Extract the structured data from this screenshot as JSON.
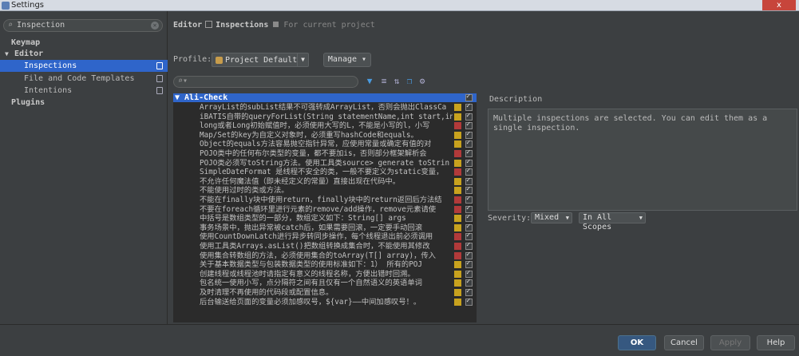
{
  "window": {
    "title": "Settings",
    "close_label": "x"
  },
  "left": {
    "search_value": "Inspection",
    "tree": [
      {
        "label": "Keymap",
        "bold": true,
        "indent": 1
      },
      {
        "label": "Editor",
        "bold": true,
        "indent": 0,
        "arrow": "▼"
      },
      {
        "label": "Inspections",
        "selected": true,
        "indent": 3
      },
      {
        "label": "File and Code Templates",
        "indent": 3
      },
      {
        "label": "Intentions",
        "indent": 3
      },
      {
        "label": "Plugins",
        "bold": true,
        "indent": 1
      }
    ]
  },
  "header": {
    "crumb_editor": "Editor",
    "crumb_inspections": "Inspections",
    "note": "For current project"
  },
  "profile": {
    "label": "Profile:",
    "value": "Project Default",
    "manage_label": "Manage ▾"
  },
  "list": {
    "group": "▼ Ali-Check",
    "rows": [
      {
        "text": "ArrayList的subList结果不可强转成ArrayList，否则会抛出ClassCa",
        "sev": "#c8a21e"
      },
      {
        "text": "iBATIS自带的queryForList(String statementName,int start,int",
        "sev": "#c8a21e"
      },
      {
        "text": "long或者Long初始赋值时，必须使用大写的L，不能是小写的l，小写",
        "sev": "#b23a3a"
      },
      {
        "text": "Map/Set的key为自定义对象时，必须重写hashCode和equals。",
        "sev": "#c8a21e"
      },
      {
        "text": "Object的equals方法容易抛空指针异常，应使用常量或确定有值的对",
        "sev": "#c8a21e"
      },
      {
        "text": "POJO类中的任何布尔类型的变量，都不要加is，否则部分框架解析会",
        "sev": "#b23a3a"
      },
      {
        "text": "POJO类必须写toString方法。使用工具类source> generate toStrin",
        "sev": "#c8a21e"
      },
      {
        "text": "SimpleDateFormat 是线程不安全的类，一般不要定义为static变量，",
        "sev": "#b23a3a"
      },
      {
        "text": "不允许任何魔法值（即未经定义的常量）直接出现在代码中。",
        "sev": "#c8a21e"
      },
      {
        "text": "不能使用过时的类或方法。",
        "sev": "#c8a21e"
      },
      {
        "text": "不能在finally块中使用return，finally块中的return返回后方法结",
        "sev": "#b23a3a"
      },
      {
        "text": "不要在foreach循环里进行元素的remove/add操作，remove元素请使",
        "sev": "#b23a3a"
      },
      {
        "text": "中括号是数组类型的一部分，数组定义如下：String[] args",
        "sev": "#c8a21e"
      },
      {
        "text": "事务场景中，抛出异常被catch后，如果需要回滚，一定要手动回滚",
        "sev": "#c8a21e"
      },
      {
        "text": "使用CountDownLatch进行异步转同步操作，每个线程退出前必须调用",
        "sev": "#b23a3a"
      },
      {
        "text": "使用工具类Arrays.asList()把数组转换成集合时，不能使用其修改",
        "sev": "#b23a3a"
      },
      {
        "text": "使用集合转数组的方法，必须使用集合的toArray(T[] array)，传入",
        "sev": "#b23a3a"
      },
      {
        "text": "关于基本数据类型与包装数据类型的使用标准如下：1） 所有的POJ",
        "sev": "#c8a21e"
      },
      {
        "text": "创建线程或线程池时请指定有意义的线程名称，方便出错时回溯。",
        "sev": "#c8a21e"
      },
      {
        "text": "包名统一使用小写，点分隔符之间有且仅有一个自然语义的英语单词",
        "sev": "#c8a21e"
      },
      {
        "text": "及时清理不再使用的代码段或配置信息。",
        "sev": "#c8a21e"
      },
      {
        "text": "后台输送给页面的变量必须加感叹号，${var}——中间加感叹号！。",
        "sev": "#c8a21e"
      }
    ]
  },
  "description": {
    "label": "Description",
    "text": "Multiple inspections are selected. You can edit them as a single inspection."
  },
  "severity": {
    "label": "Severity:",
    "value": "Mixed",
    "scope": "In All Scopes"
  },
  "buttons": {
    "ok": "OK",
    "cancel": "Cancel",
    "apply": "Apply",
    "help": "Help"
  }
}
